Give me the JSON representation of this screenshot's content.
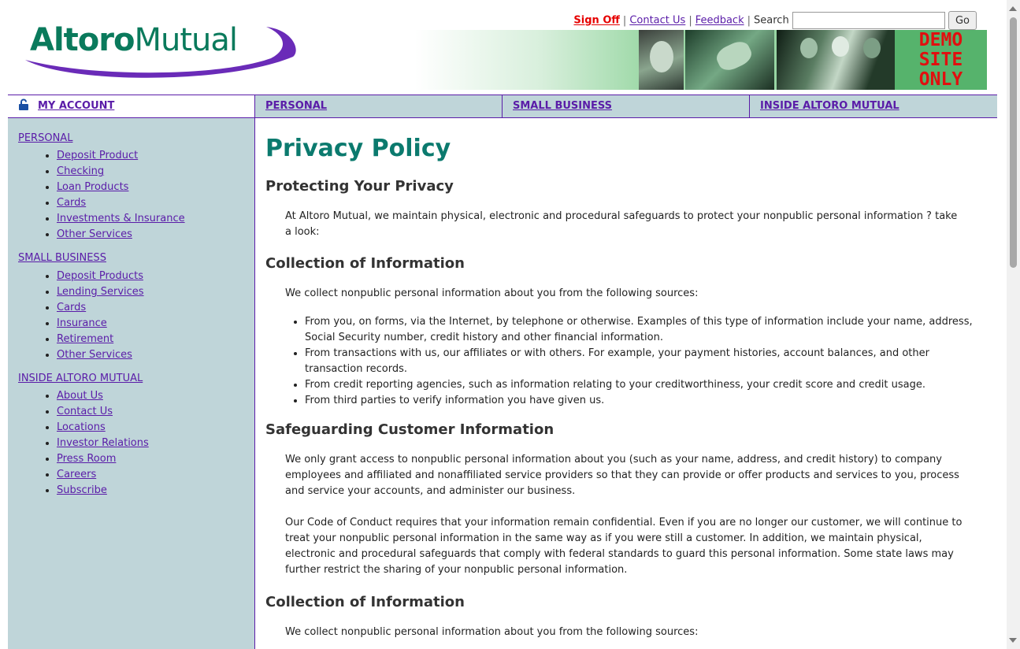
{
  "toplinks": {
    "sign_off": "Sign Off",
    "contact_us": "Contact Us",
    "feedback": "Feedback",
    "search_label": "Search",
    "search_value": "",
    "go": "Go"
  },
  "logo": {
    "bold": "Altoro",
    "rest": "Mutual"
  },
  "banner": {
    "demo": [
      "DEMO",
      "SITE",
      "ONLY"
    ]
  },
  "nav": {
    "my_account": "MY ACCOUNT",
    "personal": "PERSONAL",
    "small_business": "SMALL BUSINESS",
    "inside": "INSIDE ALTORO MUTUAL"
  },
  "sidebar": {
    "personal": {
      "title": "PERSONAL",
      "items": [
        "Deposit Product",
        "Checking",
        "Loan Products",
        "Cards",
        "Investments & Insurance",
        "Other Services"
      ]
    },
    "small_business": {
      "title": "SMALL BUSINESS",
      "items": [
        "Deposit Products",
        "Lending Services",
        "Cards",
        "Insurance",
        "Retirement",
        "Other Services"
      ]
    },
    "inside": {
      "title": "INSIDE ALTORO MUTUAL",
      "items": [
        "About Us",
        "Contact Us",
        "Locations",
        "Investor Relations",
        "Press Room",
        "Careers",
        "Subscribe"
      ]
    }
  },
  "content": {
    "title": "Privacy Policy",
    "h_protect": "Protecting Your Privacy",
    "p_protect": "At Altoro Mutual, we maintain physical, electronic and procedural safeguards to protect your nonpublic personal information ? take a look:",
    "h_collection": "Collection of Information",
    "p_collection": "We collect nonpublic personal information about you from the following sources:",
    "bullets": [
      "From you, on forms, via the Internet, by telephone or otherwise. Examples of this type of information include your name, address, Social Security number, credit history and other financial information.",
      "From transactions with us, our affiliates or with others. For example, your payment histories, account balances, and other transaction records.",
      "From credit reporting agencies, such as information relating to your creditworthiness, your credit score and credit usage.",
      "From third parties to verify information you have given us."
    ],
    "h_safeguard": "Safeguarding Customer Information",
    "p_safeguard1": "We only grant access to nonpublic personal information about you (such as your name, address, and credit history) to company employees and affiliated and nonaffiliated service providers so that they can provide or offer products and services to you, process and service your accounts, and administer our business.",
    "p_safeguard2": "Our Code of Conduct requires that your information remain confidential. Even if you are no longer our customer, we will continue to treat your nonpublic personal information in the same way as if you were still a customer. In addition, we maintain physical, electronic and procedural safeguards that comply with federal standards to guard this personal information. Some state laws may further restrict the sharing of your nonpublic personal information.",
    "h_collection2": "Collection of Information",
    "p_collection2": "We collect nonpublic personal information about you from the following sources:"
  },
  "colors": {
    "link": "#5a1ca8",
    "sign_off": "#e60000",
    "title": "#0b7a6e",
    "sidebar_bg": "#bfd5d9",
    "demo_bg": "#56b36c",
    "demo_text": "#e10f0f"
  }
}
